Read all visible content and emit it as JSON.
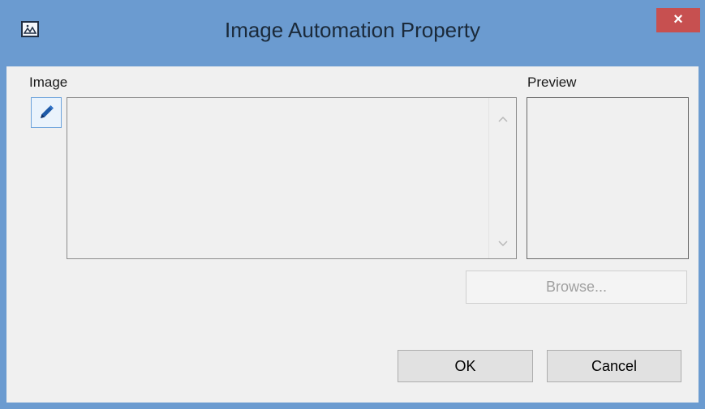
{
  "window": {
    "title": "Image Automation Property",
    "close_label": "×",
    "icon": "image-icon"
  },
  "image_section": {
    "label": "Image",
    "edit_icon": "pencil-icon",
    "scroll_up_icon": "chevron-up-icon",
    "scroll_down_icon": "chevron-down-icon"
  },
  "preview_section": {
    "label": "Preview"
  },
  "buttons": {
    "browse": "Browse...",
    "ok": "OK",
    "cancel": "Cancel"
  },
  "colors": {
    "titlebar": "#6b9bd0",
    "close_button": "#c75050",
    "client_background": "#f0f0f0",
    "edit_button_border": "#6da3dc",
    "pencil": "#1e5aa8"
  }
}
